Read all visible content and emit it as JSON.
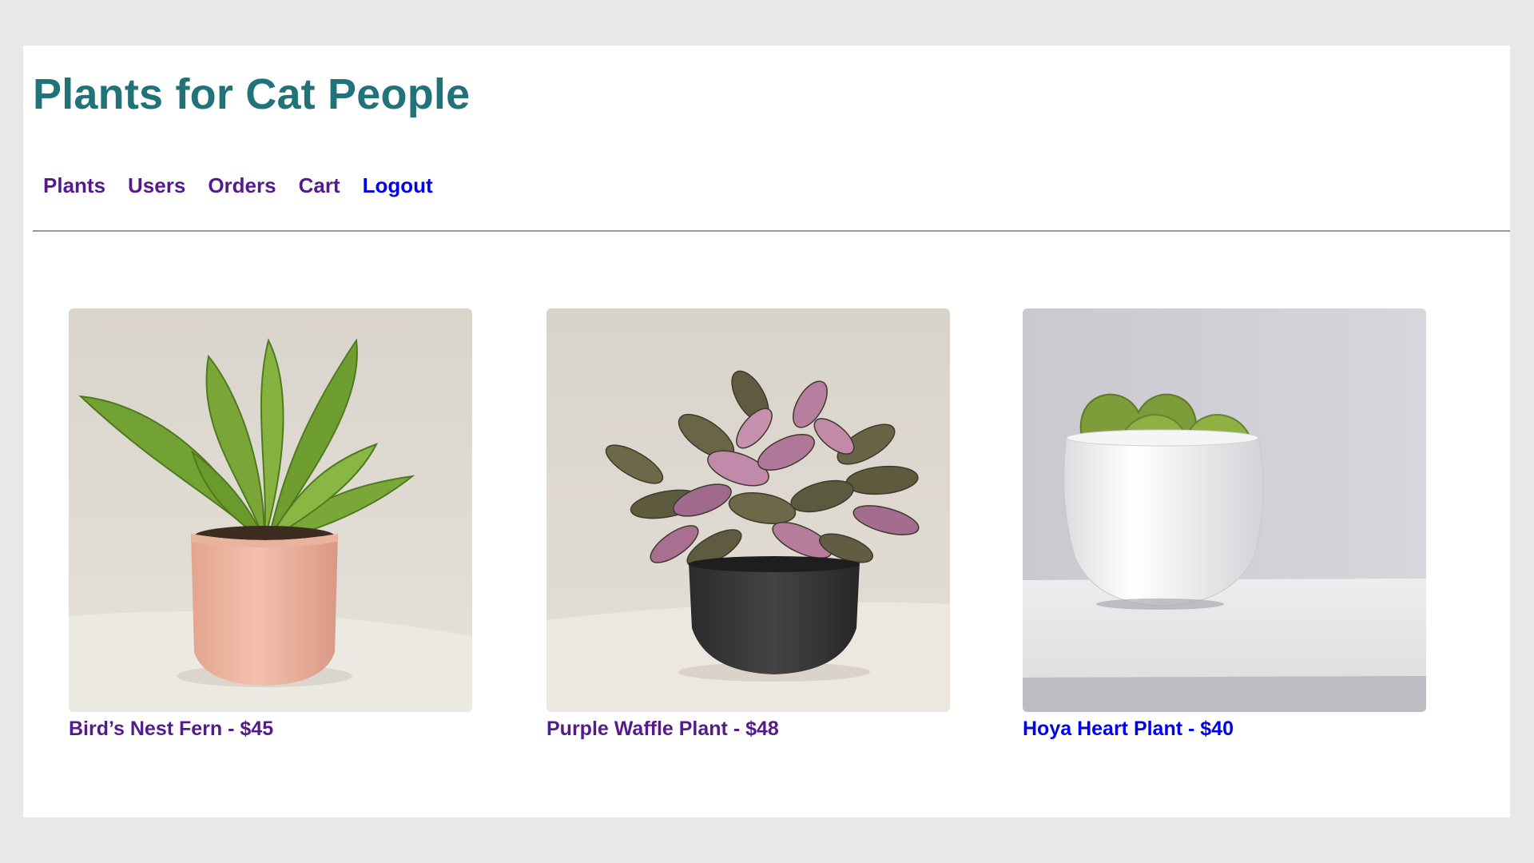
{
  "header": {
    "title": "Plants for Cat People"
  },
  "nav": {
    "items": [
      {
        "label": "Plants",
        "state": "visited"
      },
      {
        "label": "Users",
        "state": "visited"
      },
      {
        "label": "Orders",
        "state": "visited"
      },
      {
        "label": "Cart",
        "state": "visited"
      },
      {
        "label": "Logout",
        "state": "unvisited"
      }
    ]
  },
  "products": [
    {
      "name": "Bird’s Nest Fern",
      "price": "$45",
      "caption": "Bird’s Nest Fern - $45",
      "image": "birds-nest-fern-in-pink-pot",
      "link_state": "visited"
    },
    {
      "name": "Purple Waffle Plant",
      "price": "$48",
      "caption": "Purple Waffle Plant - $48",
      "image": "purple-waffle-plant-in-black-pot",
      "link_state": "visited"
    },
    {
      "name": "Hoya Heart Plant",
      "price": "$40",
      "caption": "Hoya Heart Plant - $40",
      "image": "hoya-heart-plant-in-white-pot",
      "link_state": "unvisited"
    }
  ],
  "colors": {
    "title": "#1f7379",
    "visited_link": "#551a8b",
    "unvisited_link": "#0000ee",
    "page_background": "#e9e8e6",
    "content_background": "#ffffff"
  }
}
